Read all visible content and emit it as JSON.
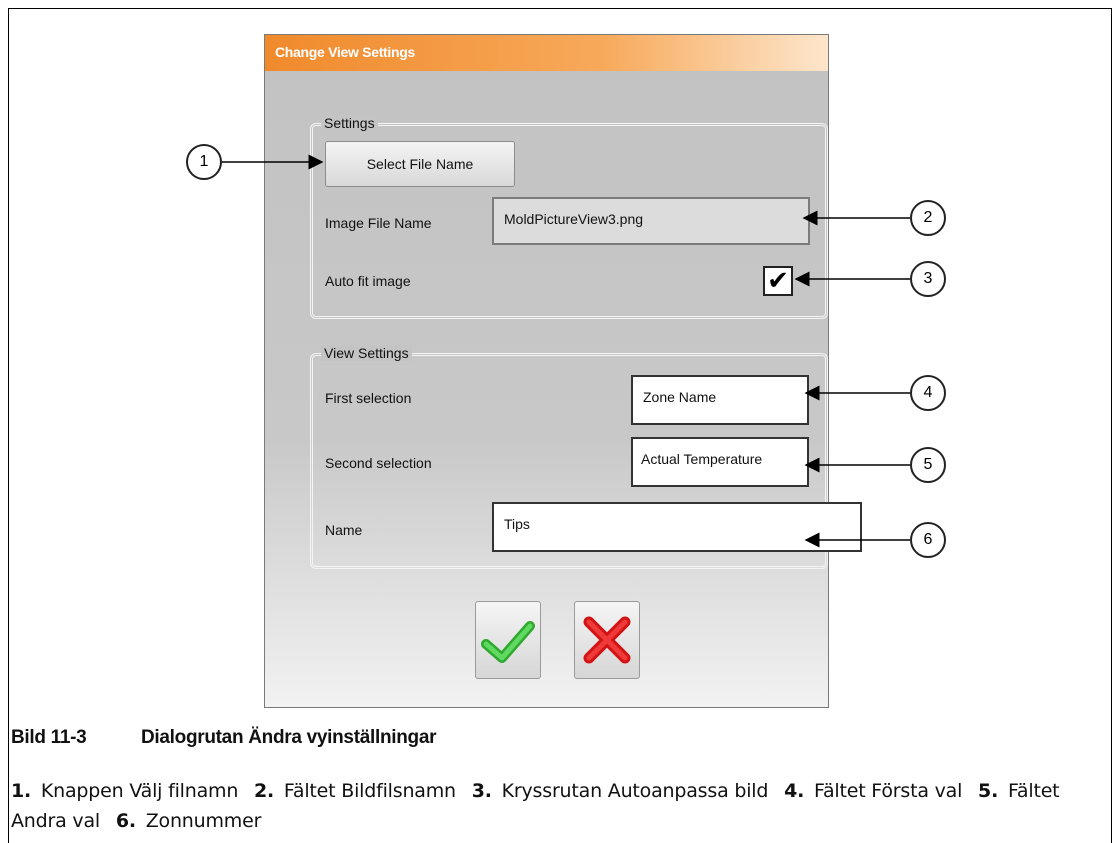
{
  "dialog": {
    "title": "Change View Settings",
    "settings_group": {
      "title": "Settings",
      "select_button": "Select File Name",
      "image_file_label": "Image File Name",
      "image_file_value": "MoldPictureView3.png",
      "auto_fit_label": "Auto fit image",
      "auto_fit_checked": true
    },
    "view_group": {
      "title": "View Settings",
      "first_label": "First selection",
      "first_value": "Zone Name",
      "second_label": "Second selection",
      "second_value": "Actual Temperature",
      "name_label": "Name",
      "name_value": "Tips"
    },
    "ok_icon": "green-check-icon",
    "cancel_icon": "red-x-icon"
  },
  "callouts": [
    "1",
    "2",
    "3",
    "4",
    "5",
    "6"
  ],
  "figure": {
    "number": "Bild 11-3",
    "title": "Dialogrutan Ändra vyinställningar"
  },
  "legend": [
    {
      "num": "1.",
      "text": "Knappen Välj filnamn"
    },
    {
      "num": "2.",
      "text": "Fältet Bildfilsnamn"
    },
    {
      "num": "3.",
      "text": "Kryssrutan Autoanpassa bild"
    },
    {
      "num": "4.",
      "text": "Fältet Första val"
    },
    {
      "num": "5.",
      "text": "Fältet Andra val"
    },
    {
      "num": "6.",
      "text": "Zonnummer"
    }
  ],
  "colors": {
    "titlebar": "#f08a2c",
    "ok": "#3cc83c",
    "cancel": "#e21b1b"
  }
}
